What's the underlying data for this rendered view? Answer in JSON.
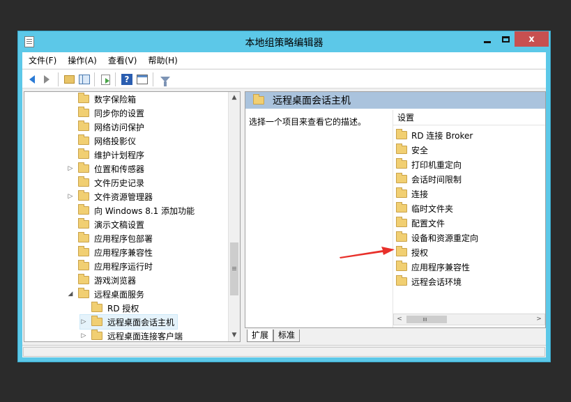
{
  "window": {
    "title": "本地组策略编辑器",
    "close_glyph": "x"
  },
  "menu": [
    "文件(F)",
    "操作(A)",
    "查看(V)",
    "帮助(H)"
  ],
  "toolbar": {
    "icons": [
      "back-icon",
      "forward-icon",
      "up-folder-icon",
      "show-hide-tree-icon",
      "export-list-icon",
      "help-icon",
      "properties-icon",
      "filter-icon"
    ],
    "help_glyph": "?"
  },
  "tree": {
    "items": [
      {
        "label": "数字保险箱",
        "expander": ""
      },
      {
        "label": "同步你的设置",
        "expander": ""
      },
      {
        "label": "网络访问保护",
        "expander": ""
      },
      {
        "label": "网络投影仪",
        "expander": ""
      },
      {
        "label": "维护计划程序",
        "expander": ""
      },
      {
        "label": "位置和传感器",
        "expander": "▷"
      },
      {
        "label": "文件历史记录",
        "expander": ""
      },
      {
        "label": "文件资源管理器",
        "expander": "▷"
      },
      {
        "label": "向 Windows 8.1 添加功能",
        "expander": ""
      },
      {
        "label": "演示文稿设置",
        "expander": ""
      },
      {
        "label": "应用程序包部署",
        "expander": ""
      },
      {
        "label": "应用程序兼容性",
        "expander": ""
      },
      {
        "label": "应用程序运行时",
        "expander": ""
      },
      {
        "label": "游戏浏览器",
        "expander": ""
      },
      {
        "label": "远程桌面服务",
        "expander": "◢"
      },
      {
        "label": "RD 授权",
        "expander": ""
      },
      {
        "label": "远程桌面会话主机",
        "expander": "▷",
        "selected": true
      },
      {
        "label": "远程桌面连接客户端",
        "expander": "▷"
      }
    ],
    "scroll_up": "▲",
    "scroll_down": "▼"
  },
  "right": {
    "header_title": "远程桌面会话主机",
    "description": "选择一个项目来查看它的描述。",
    "column_header": "设置",
    "settings": [
      "RD 连接 Broker",
      "安全",
      "打印机重定向",
      "会话时间限制",
      "连接",
      "临时文件夹",
      "配置文件",
      "设备和资源重定向",
      "授权",
      "应用程序兼容性",
      "远程会话环境"
    ],
    "scroll_left": "<",
    "scroll_right": ">"
  },
  "tabs": [
    "扩展",
    "标准"
  ],
  "colors": {
    "window_frame": "#5cc8e8",
    "close_button": "#c75050",
    "header_band": "#aac3dd",
    "folder": "#f1cf72",
    "annotation_arrow": "#e8302a"
  }
}
